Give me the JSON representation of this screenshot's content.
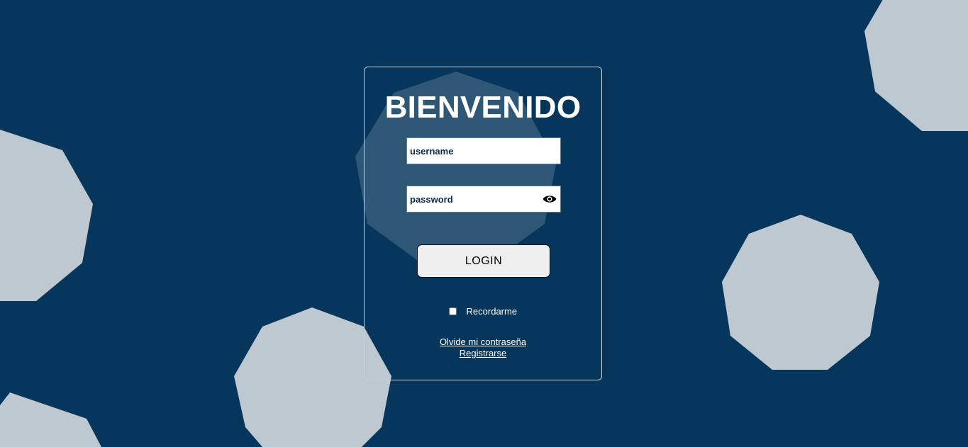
{
  "page": {
    "background_color": "#06365b",
    "shape_color": "#bec8d0"
  },
  "login": {
    "title": "BIENVENIDO",
    "username_placeholder": "username",
    "password_placeholder": "password",
    "password_toggle_icon": "eye-icon",
    "login_label": "LOGIN",
    "remember_label": "Recordarme",
    "remember_checked": false,
    "forgot_link": "Olvide mi contraseña",
    "register_link": "Registrarse"
  }
}
